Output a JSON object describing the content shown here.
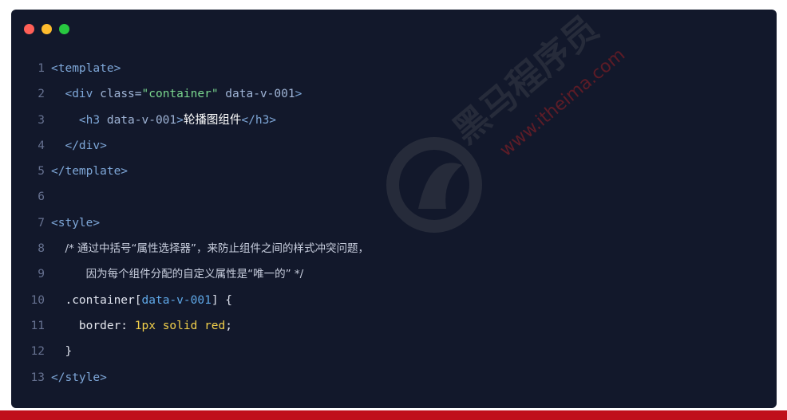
{
  "window_controls": {
    "close_color": "#ff5f57",
    "minimize_color": "#febc2e",
    "maximize_color": "#28c840"
  },
  "code_lines": [
    {
      "number": "1",
      "parts": [
        {
          "cls": "tag",
          "text": "<template>"
        }
      ]
    },
    {
      "number": "2",
      "parts": [
        {
          "cls": "plain",
          "text": "  "
        },
        {
          "cls": "tag",
          "text": "<div "
        },
        {
          "cls": "attr",
          "text": "class="
        },
        {
          "cls": "str",
          "text": "\"container\""
        },
        {
          "cls": "attr",
          "text": " data-v-001"
        },
        {
          "cls": "tag",
          "text": ">"
        }
      ]
    },
    {
      "number": "3",
      "parts": [
        {
          "cls": "plain",
          "text": "    "
        },
        {
          "cls": "tag",
          "text": "<h3 "
        },
        {
          "cls": "attr",
          "text": "data-v-001"
        },
        {
          "cls": "tag",
          "text": ">"
        },
        {
          "cls": "txt",
          "text": "轮播图组件"
        },
        {
          "cls": "tag",
          "text": "</h3>"
        }
      ]
    },
    {
      "number": "4",
      "parts": [
        {
          "cls": "plain",
          "text": "  "
        },
        {
          "cls": "tag",
          "text": "</div>"
        }
      ]
    },
    {
      "number": "5",
      "parts": [
        {
          "cls": "tag",
          "text": "</template>"
        }
      ]
    },
    {
      "number": "6",
      "parts": []
    },
    {
      "number": "7",
      "parts": [
        {
          "cls": "tag",
          "text": "<style>"
        }
      ]
    },
    {
      "number": "8",
      "parts": [
        {
          "cls": "plain",
          "text": "  "
        },
        {
          "cls": "cmt",
          "text": "/* 通过中括号“属性选择器”，来防止组件之间的样式冲突问题，"
        }
      ]
    },
    {
      "number": "9",
      "parts": [
        {
          "cls": "plain",
          "text": "     "
        },
        {
          "cls": "cmt",
          "text": "因为每个组件分配的自定义属性是“唯一的” */"
        }
      ]
    },
    {
      "number": "10",
      "parts": [
        {
          "cls": "plain",
          "text": "  "
        },
        {
          "cls": "sel",
          "text": ".container"
        },
        {
          "cls": "brk",
          "text": "["
        },
        {
          "cls": "sattr",
          "text": "data-v-001"
        },
        {
          "cls": "brk",
          "text": "] {"
        }
      ]
    },
    {
      "number": "11",
      "parts": [
        {
          "cls": "plain",
          "text": "    "
        },
        {
          "cls": "prop",
          "text": "border: "
        },
        {
          "cls": "num",
          "text": "1px"
        },
        {
          "cls": "kw",
          "text": " solid red"
        },
        {
          "cls": "prop",
          "text": ";"
        }
      ]
    },
    {
      "number": "12",
      "parts": [
        {
          "cls": "plain",
          "text": "  "
        },
        {
          "cls": "brk",
          "text": "}"
        }
      ]
    },
    {
      "number": "13",
      "parts": [
        {
          "cls": "tag",
          "text": "</style>"
        }
      ]
    }
  ],
  "watermark": {
    "brand_text": "黑马程序员",
    "url_text": "www.itheima.com",
    "color": "#cc2222"
  },
  "bottom_bar_color": "#c0101b"
}
